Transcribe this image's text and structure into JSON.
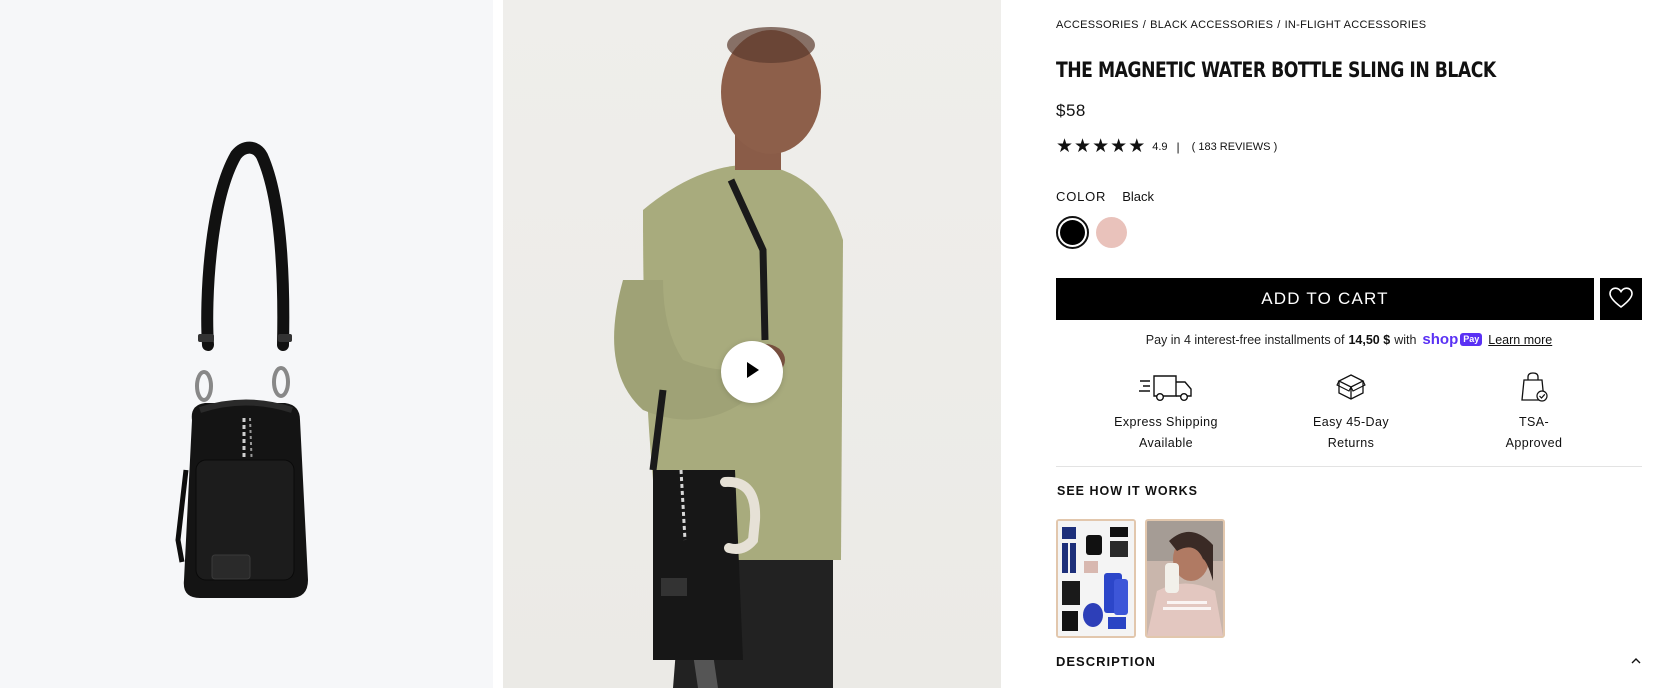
{
  "gallery": {
    "play_icon": "play-icon"
  },
  "product": {
    "breadcrumb": [
      "ACCESSORIES",
      "BLACK ACCESSORIES",
      "IN-FLIGHT ACCESSORIES"
    ],
    "breadcrumb_separator": "/",
    "title": "THE MAGNETIC WATER BOTTLE SLING IN BLACK",
    "price": "$58",
    "rating": {
      "value": "4.9",
      "stars": 5,
      "divider": "|",
      "reviews_label": "( 183 REVIEWS )"
    },
    "color": {
      "label": "COLOR",
      "selected": "Black",
      "swatches": [
        {
          "name": "Black",
          "hex": "#000000",
          "selected": true
        },
        {
          "name": "Pink",
          "hex": "#e9c2bb",
          "selected": false
        }
      ]
    },
    "add_to_cart_label": "ADD TO CART",
    "wishlist_icon": "heart-icon",
    "installments": {
      "prefix": "Pay in 4 interest-free installments of",
      "amount": "14,50 $",
      "with": "with",
      "brand": "shop",
      "brand_badge": "Pay",
      "learn_more": "Learn more"
    },
    "features": [
      {
        "icon": "truck-icon",
        "line1": "Express Shipping",
        "line2": "Available"
      },
      {
        "icon": "box-icon",
        "line1": "Easy 45-Day",
        "line2": "Returns"
      },
      {
        "icon": "bag-check-icon",
        "line1": "TSA-",
        "line2": "Approved"
      }
    ],
    "see_how_label": "SEE HOW IT WORKS",
    "description_label": "DESCRIPTION"
  },
  "colors": {
    "accent": "#000000",
    "shop_pay": "#5a31f4",
    "thumb_border": "#e2c7ad",
    "pink_swatch": "#e9c2bb"
  }
}
